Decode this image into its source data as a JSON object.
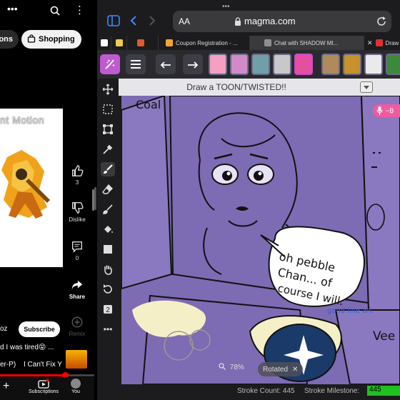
{
  "youtube": {
    "chips": [
      "ons",
      "Shopping"
    ],
    "video_title": "nt Motion",
    "actions": {
      "like_count": "3",
      "dislike_label": "Dislike",
      "comment_count": "0",
      "share_label": "Share",
      "remix_label": "Remix"
    },
    "channel_name_partial": "oz",
    "subscribe_label": "Subscribe",
    "description_line": "d I was tired😝 ...",
    "music_left": "er-P)",
    "music_right": "I Can't Fix Y",
    "progress_fraction": 0.69,
    "nav": {
      "subscriptions": "Subscriptions",
      "you": "You"
    }
  },
  "browser": {
    "aa_label": "AA",
    "url": "magma.com",
    "tabs": [
      {
        "label": "",
        "favicon": "#ffffff"
      },
      {
        "label": "",
        "favicon": "#f2c94c"
      },
      {
        "label": "",
        "favicon": "#e05a2b"
      },
      {
        "label": "Coupon Registration - ...",
        "favicon": "#f2a72c"
      },
      {
        "label": "Chat with SHADOW MI...",
        "favicon": "#8f8f8f"
      },
      {
        "label": "Draw",
        "favicon": "#e03030"
      }
    ],
    "prompt": "Draw a TOON/TWISTED!!",
    "mic_label": "~B",
    "zoom": "78%",
    "rotated_label": "Rotated",
    "stroke_count_label": "Stroke Count: 445",
    "stroke_milestone_label": "Stroke Milestone:",
    "stroke_milestone_value": "445",
    "drawing_text": {
      "coal": "Coal",
      "speech": [
        "oh pebble",
        "Chan... of",
        "course I will."
      ],
      "astro": "Astro",
      "good_line_art": "good line art",
      "vee": "Vee"
    },
    "colors": {
      "canvas": "#7d6bb3",
      "mic_pill": "#f05aa0",
      "milestone": "#21c021"
    }
  }
}
